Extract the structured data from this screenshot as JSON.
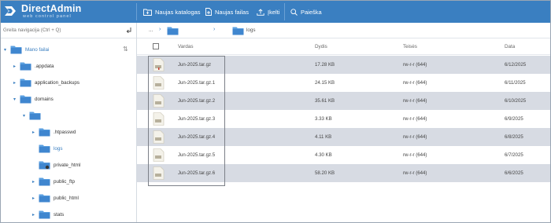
{
  "brand": {
    "name": "DirectAdmin",
    "sub": "web control panel"
  },
  "toolbar": {
    "new_folder": "Naujas katalogas",
    "new_file": "Naujas failas",
    "upload": "Įkelti",
    "search": "Paieška"
  },
  "tree": {
    "quicknav": "Greita navigacija (Ctrl + Q)",
    "items": [
      {
        "label": "Mano failai",
        "arrow": "▾"
      },
      {
        "label": ".appdata",
        "arrow": "▸"
      },
      {
        "label": "application_backups",
        "arrow": "▸"
      },
      {
        "label": "domains",
        "arrow": "▾"
      },
      {
        "label": "",
        "arrow": "▾"
      },
      {
        "label": ".htpasswd",
        "arrow": "▸"
      },
      {
        "label": "logs",
        "arrow": ""
      },
      {
        "label": "private_html",
        "arrow": ""
      },
      {
        "label": "public_ftp",
        "arrow": "▸"
      },
      {
        "label": "public_html",
        "arrow": "▸"
      },
      {
        "label": "stats",
        "arrow": "▸"
      }
    ]
  },
  "breadcrumb": {
    "dots": "...",
    "current": "logs"
  },
  "table": {
    "headers": {
      "name": "Vardas",
      "size": "Dydis",
      "perms": "Teisės",
      "date": "Data"
    },
    "rows": [
      {
        "name": "Jun-2025.tar.gz",
        "size": "17.28 KB",
        "perms": "rw-r-r (644)",
        "date": "6/12/2025"
      },
      {
        "name": "Jun-2025.tar.gz.1",
        "size": "24.15 KB",
        "perms": "rw-r-r (644)",
        "date": "6/11/2025"
      },
      {
        "name": "Jun-2025.tar.gz.2",
        "size": "35.61 KB",
        "perms": "rw-r-r (644)",
        "date": "6/10/2025"
      },
      {
        "name": "Jun-2025.tar.gz.3",
        "size": "3.33 KB",
        "perms": "rw-r-r (644)",
        "date": "6/9/2025"
      },
      {
        "name": "Jun-2025.tar.gz.4",
        "size": "4.11 KB",
        "perms": "rw-r-r (644)",
        "date": "6/8/2025"
      },
      {
        "name": "Jun-2025.tar.gz.5",
        "size": "4.30 KB",
        "perms": "rw-r-r (644)",
        "date": "6/7/2025"
      },
      {
        "name": "Jun-2025.tar.gz.6",
        "size": "58.20 KB",
        "perms": "rw-r-r (644)",
        "date": "6/6/2025"
      }
    ]
  },
  "colors": {
    "accent": "#3a7fc1",
    "row_alt": "#d7dbe3",
    "folder": "#5a9fe0"
  },
  "icons": {
    "folder": "folder-icon",
    "archive": "archive-file-icon",
    "search": "search-icon"
  }
}
